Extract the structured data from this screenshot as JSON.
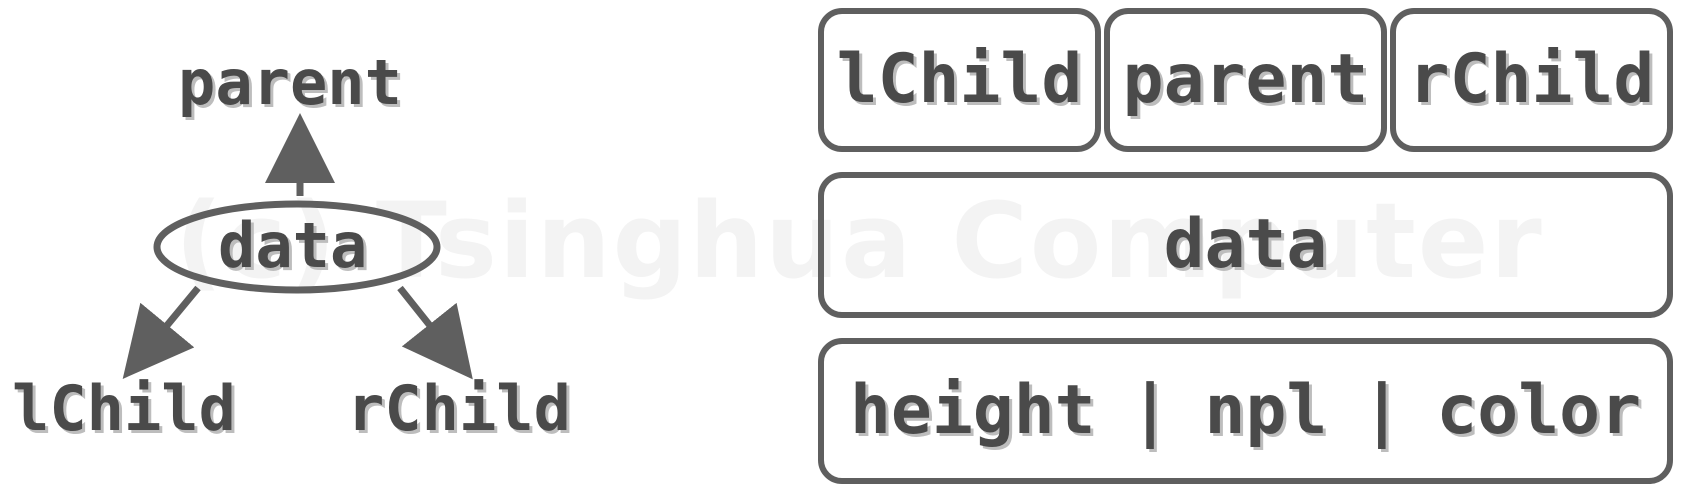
{
  "watermark": "(c) Tsinghua Computer",
  "tree": {
    "parent": "parent",
    "node": "data",
    "left": "lChild",
    "right": "rChild"
  },
  "struct": {
    "row1": [
      "lChild",
      "parent",
      "rChild"
    ],
    "row2": "data",
    "row3": [
      "height",
      "npl",
      "color"
    ],
    "separator": "|"
  },
  "colors": {
    "stroke": "#5f5f5f",
    "text": "#4a4a4a",
    "watermark": "#f3f3f3"
  }
}
